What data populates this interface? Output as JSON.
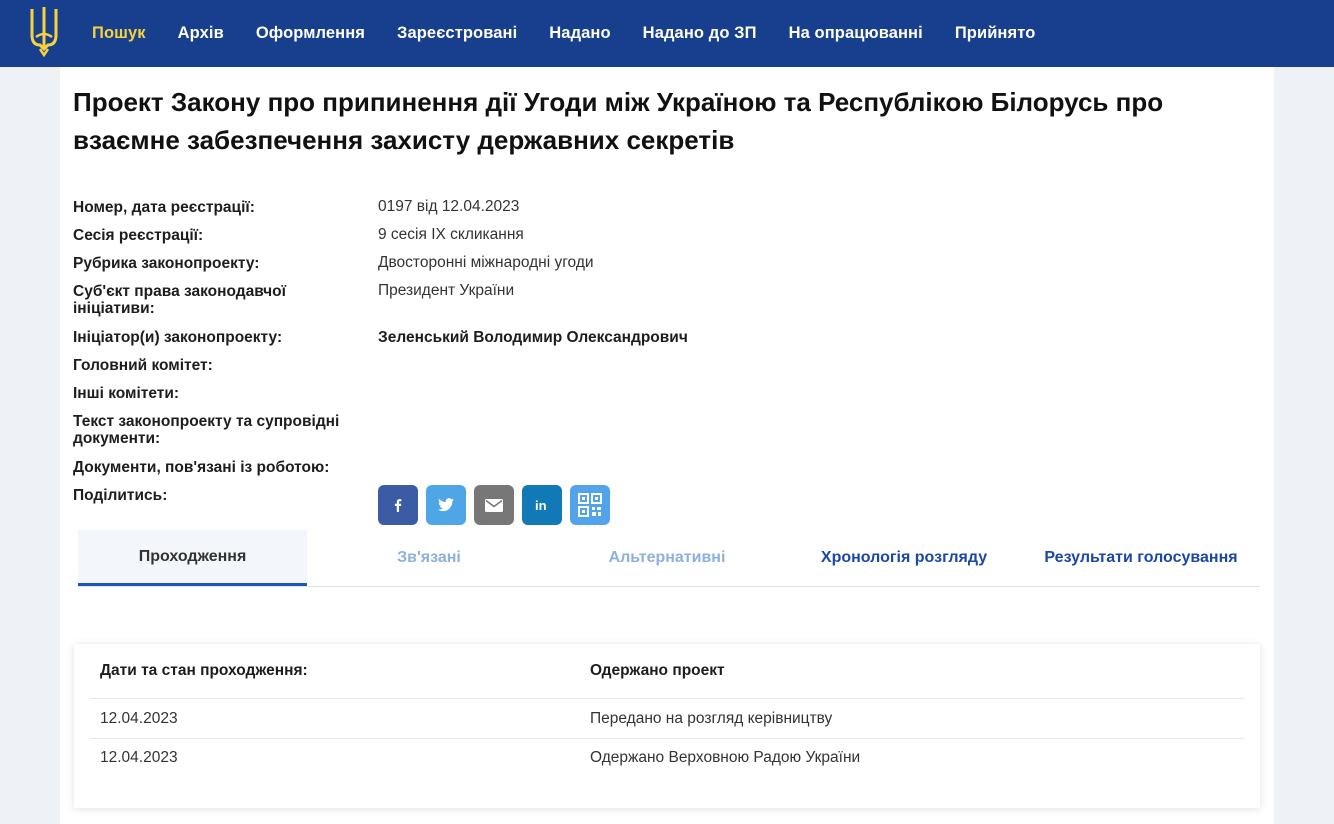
{
  "nav": {
    "items": [
      "Пошук",
      "Архів",
      "Оформлення",
      "Зареєстровані",
      "Надано",
      "Надано до ЗП",
      "На опрацюванні",
      "Прийнято"
    ]
  },
  "bill": {
    "title": "Проект Закону про припинення дії Угоди між Україною та Республікою Білорусь про взаємне забезпечення захисту державних секретів",
    "fields": [
      {
        "label": "Номер, дата реєстрації:",
        "value": "0197 від 12.04.2023"
      },
      {
        "label": "Сесія реєстрації:",
        "value": "9 сесія IX скликання"
      },
      {
        "label": "Рубрика законопроекту:",
        "value": "Двосторонні міжнародні угоди"
      },
      {
        "label": "Суб'єкт права законодавчої ініціативи:",
        "value": "Президент України"
      },
      {
        "label": "Ініціатор(и) законопроекту:",
        "value": "Зеленський Володимир Олександрович"
      },
      {
        "label": "Головний комітет:",
        "value": ""
      },
      {
        "label": "Інші комітети:",
        "value": ""
      },
      {
        "label": "Текст законопроекту та супровідні документи:",
        "value": ""
      },
      {
        "label": "Документи, пов'язані із роботою:",
        "value": ""
      },
      {
        "label": "Поділитись:",
        "value": ""
      }
    ]
  },
  "share": {
    "buttons": [
      {
        "name": "facebook",
        "icon": "facebook-icon",
        "color": "#3b5ba5"
      },
      {
        "name": "twitter",
        "icon": "twitter-icon",
        "color": "#4ea6e6"
      },
      {
        "name": "email",
        "icon": "email-icon",
        "color": "#777777"
      },
      {
        "name": "linkedin",
        "icon": "linkedin-icon",
        "color": "#1179b6"
      },
      {
        "name": "qr",
        "icon": "qr-code-icon",
        "color": "#52a3ea"
      }
    ]
  },
  "tabs": [
    "Проходження",
    "Зв'язані",
    "Альтернативні",
    "Хронологія розгляду",
    "Результати голосування"
  ],
  "passage": {
    "header_left": "Дати та стан проходження:",
    "header_right": "Одержано проект",
    "rows": [
      {
        "date": "12.04.2023",
        "status": "Передано на розгляд керівництву"
      },
      {
        "date": "12.04.2023",
        "status": "Одержано Верховною Радою України"
      }
    ]
  },
  "colors": {
    "header_bg": "#173f8d",
    "active_nav": "#f5d33c",
    "tab_link": "#1b47a8",
    "tab_disabled": "#8eb0de"
  }
}
